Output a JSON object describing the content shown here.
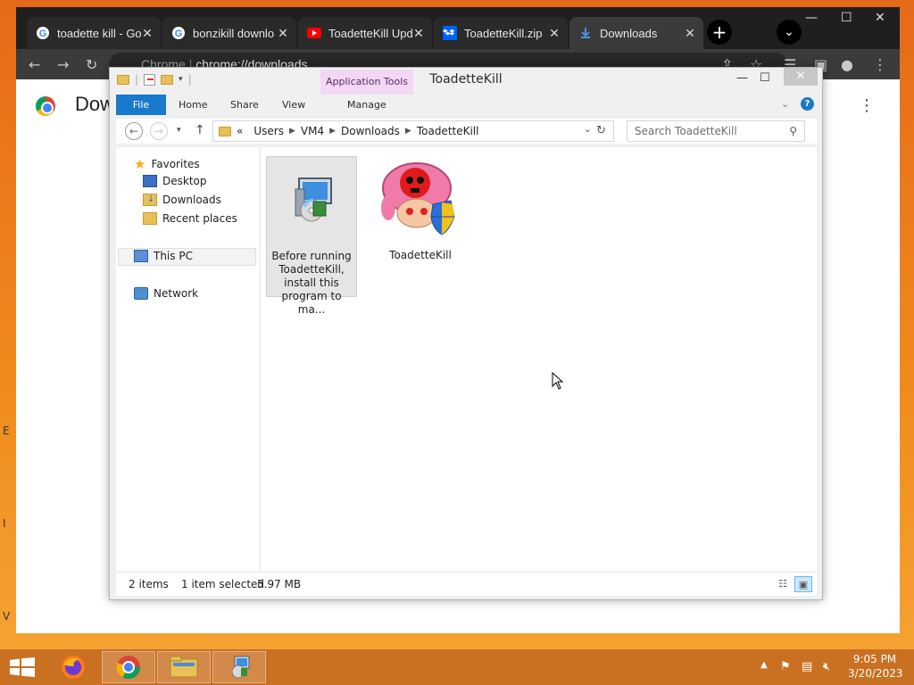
{
  "browser": {
    "tabs": [
      {
        "title": "toadette kill - Go",
        "favicon": "google-icon"
      },
      {
        "title": "bonzikill downlo",
        "favicon": "google-icon"
      },
      {
        "title": "ToadetteKill Upd",
        "favicon": "youtube-icon"
      },
      {
        "title": "ToadetteKill.zip",
        "favicon": "dropbox-icon"
      },
      {
        "title": "Downloads",
        "favicon": "download-icon"
      }
    ],
    "url_prefix": "Chrome",
    "url": "chrome://downloads",
    "page_title": "Dow"
  },
  "explorer": {
    "title": "ToadetteKill",
    "context_tab": "Application Tools",
    "ribbon_tabs": [
      "File",
      "Home",
      "Share",
      "View"
    ],
    "manage_tab": "Manage",
    "breadcrumb": [
      "Users",
      "VM4",
      "Downloads",
      "ToadetteKill"
    ],
    "breadcrumb_overflow": "«",
    "search_placeholder": "Search ToadetteKill",
    "nav": {
      "favorites": "Favorites",
      "desktop": "Desktop",
      "downloads": "Downloads",
      "recent": "Recent places",
      "this_pc": "This PC",
      "network": "Network"
    },
    "files": [
      {
        "name_lines": [
          "Before running",
          "ToadetteKill,",
          "install this",
          "program to ma..."
        ],
        "icon": "installer-icon",
        "selected": true
      },
      {
        "name_lines": [
          "ToadetteKill"
        ],
        "icon": "toadette-skull-icon",
        "selected": false
      }
    ],
    "status": {
      "items": "2 items",
      "selected": "1 item selected",
      "size": "5.97 MB"
    }
  },
  "taskbar": {
    "time": "9:05 PM",
    "date": "3/20/2023"
  },
  "colors": {
    "file_tab": "#1979ca",
    "app_tools": "#f3d8f6",
    "taskbar": "#c56b20",
    "desktop": "#e56a1a"
  }
}
